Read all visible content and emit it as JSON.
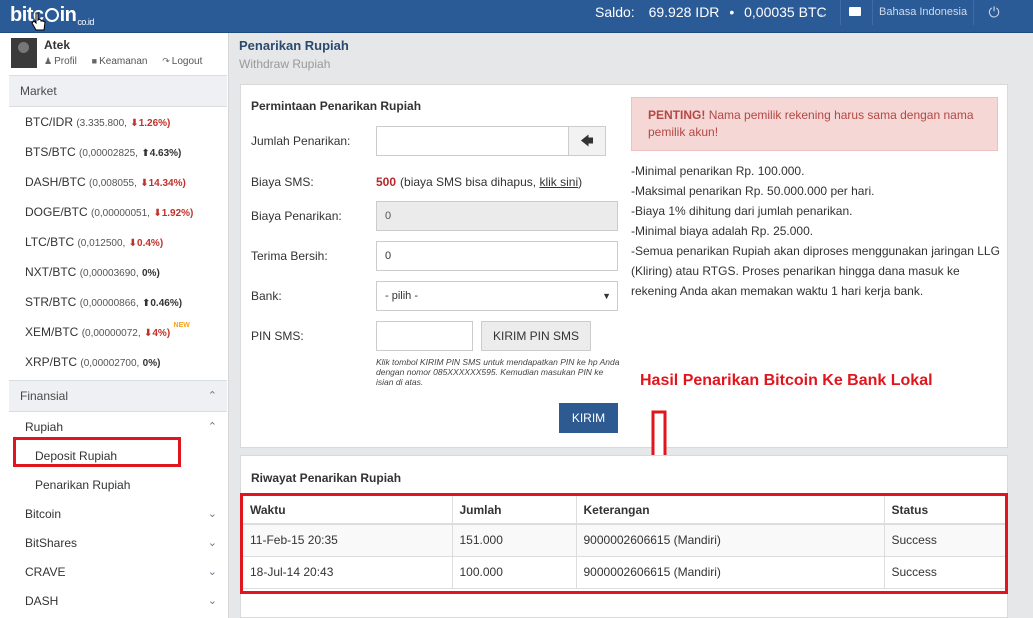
{
  "topbar": {
    "logo_main": "bitc",
    "logo_rest": "in",
    "logo_tld": "co.id",
    "balance_label": "Saldo:",
    "balance_idr": "69.928 IDR",
    "balance_sep": "•",
    "balance_btc": "0,00035 BTC",
    "language": "Bahasa Indonesia"
  },
  "user": {
    "name": "Atek",
    "links": {
      "profile": "Profil",
      "security": "Keamanan",
      "logout": "Logout"
    }
  },
  "sidebar": {
    "market_title": "Market",
    "markets": [
      {
        "pair": "BTC/IDR",
        "price": "(3.335.800,",
        "change": "1.26%)",
        "dir": "down",
        "arrow": "⬇"
      },
      {
        "pair": "BTS/BTC",
        "price": "(0,00002825,",
        "change": "4.63%)",
        "dir": "up",
        "arrow": "⬆"
      },
      {
        "pair": "DASH/BTC",
        "price": "(0,008055,",
        "change": "14.34%)",
        "dir": "down",
        "arrow": "⬇"
      },
      {
        "pair": "DOGE/BTC",
        "price": "(0,00000051,",
        "change": "1.92%)",
        "dir": "down",
        "arrow": "⬇"
      },
      {
        "pair": "LTC/BTC",
        "price": "(0,012500,",
        "change": "0.4%)",
        "dir": "down",
        "arrow": "⬇"
      },
      {
        "pair": "NXT/BTC",
        "price": "(0,00003690,",
        "change": "0%)",
        "dir": "flat",
        "arrow": ""
      },
      {
        "pair": "STR/BTC",
        "price": "(0,00000866,",
        "change": "0.46%)",
        "dir": "up",
        "arrow": "⬆"
      },
      {
        "pair": "XEM/BTC",
        "price": "(0,00000072,",
        "change": "4%)",
        "dir": "down",
        "arrow": "⬇",
        "badge": "NEW"
      },
      {
        "pair": "XRP/BTC",
        "price": "(0,00002700,",
        "change": "0%)",
        "dir": "flat",
        "arrow": ""
      }
    ],
    "finance_title": "Finansial",
    "nav": {
      "rupiah": "Rupiah",
      "deposit": "Deposit Rupiah",
      "withdraw": "Penarikan Rupiah",
      "bitcoin": "Bitcoin",
      "bitshares": "BitShares",
      "crave": "CRAVE",
      "dash": "DASH"
    }
  },
  "page": {
    "title": "Penarikan Rupiah",
    "subtitle": "Withdraw Rupiah"
  },
  "form": {
    "title": "Permintaan Penarikan Rupiah",
    "amount_label": "Jumlah Penarikan:",
    "amount_value": "",
    "sms_fee_label": "Biaya SMS:",
    "sms_fee_value": "500",
    "sms_fee_note": "(biaya SMS bisa dihapus,",
    "sms_fee_link": "klik sini",
    "sms_fee_close": ")",
    "withdraw_fee_label": "Biaya Penarikan:",
    "withdraw_fee_value": "0",
    "net_label": "Terima Bersih:",
    "net_value": "0",
    "bank_label": "Bank:",
    "bank_selected": "- pilih -",
    "pin_label": "PIN SMS:",
    "pin_value": "",
    "pin_button": "KIRIM PIN SMS",
    "pin_note": "Klik tombol KIRIM PIN SMS untuk mendapatkan PIN ke hp Anda dengan nomor 085XXXXXX595. Kemudian masukan PIN ke isian di atas.",
    "submit": "KIRIM"
  },
  "alert": {
    "strong": "PENTING!",
    "text": "Nama pemilik rekening harus sama dengan nama pemilik akun!"
  },
  "rules": [
    "-Minimal penarikan Rp. 100.000.",
    "-Maksimal penarikan Rp. 50.000.000 per hari.",
    "-Biaya 1% dihitung dari jumlah penarikan.",
    "-Minimal biaya adalah Rp. 25.000.",
    "-Semua penarikan Rupiah akan diproses menggunakan jaringan LLG (Kliring) atau RTGS. Proses penarikan hingga dana masuk ke rekening Anda akan memakan waktu 1 hari kerja bank."
  ],
  "annotation": "Hasil Penarikan Bitcoin Ke Bank Lokal",
  "history": {
    "title": "Riwayat Penarikan Rupiah",
    "headers": [
      "Waktu",
      "Jumlah",
      "Keterangan",
      "Status"
    ],
    "rows": [
      [
        "11-Feb-15 20:35",
        "151.000",
        "9000002606615 (Mandiri)",
        "Success"
      ],
      [
        "18-Jul-14 20:43",
        "100.000",
        "9000002606615 (Mandiri)",
        "Success"
      ]
    ]
  },
  "colors": {
    "brand": "#2b5b96",
    "accent_red": "#e0161e",
    "submit": "#2d5a91",
    "alert_bg": "#f5d7d6"
  }
}
